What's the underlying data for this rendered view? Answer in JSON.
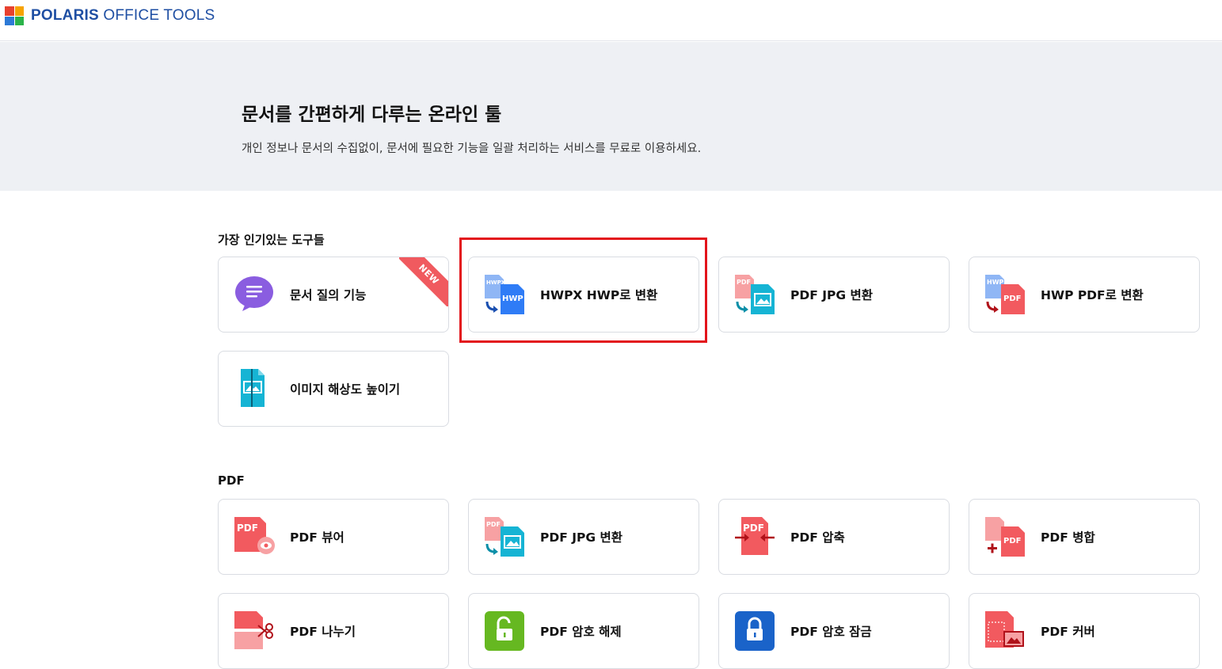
{
  "app": {
    "logo_bold": "POLARIS",
    "logo_rest": " OFFICE TOOLS",
    "logo_colors": [
      "#e8412f",
      "#f7a300",
      "#2d7ad6",
      "#2bb34a"
    ]
  },
  "hero": {
    "title": "문서를 간편하게 다루는 온라인 툴",
    "subtitle": "개인 정보나 문서의 수집없이, 문서에 필요한 기능을 일괄 처리하는 서비스를 무료로 이용하세요."
  },
  "popular": {
    "title": "가장 인기있는 도구들",
    "items": [
      {
        "label": "문서 질의 기능",
        "icon": "chat-bubble-icon",
        "badge": "NEW"
      },
      {
        "label": "HWPX HWP로 변환",
        "icon": "hwpx-to-hwp-icon"
      },
      {
        "label": "PDF JPG 변환",
        "icon": "pdf-to-jpg-icon"
      },
      {
        "label": "HWP PDF로 변환",
        "icon": "hwp-to-pdf-icon"
      },
      {
        "label": "이미지 해상도 높이기",
        "icon": "image-upscale-icon"
      }
    ]
  },
  "pdf": {
    "title": "PDF",
    "items": [
      {
        "label": "PDF 뷰어",
        "icon": "pdf-viewer-icon"
      },
      {
        "label": "PDF JPG 변환",
        "icon": "pdf-to-jpg-icon"
      },
      {
        "label": "PDF 압축",
        "icon": "pdf-compress-icon"
      },
      {
        "label": "PDF 병합",
        "icon": "pdf-merge-icon"
      },
      {
        "label": "PDF 나누기",
        "icon": "pdf-split-icon"
      },
      {
        "label": "PDF 암호 해제",
        "icon": "pdf-unlock-icon"
      },
      {
        "label": "PDF 암호 잠금",
        "icon": "pdf-lock-icon"
      },
      {
        "label": "PDF 커버",
        "icon": "pdf-cover-icon"
      }
    ]
  },
  "colors": {
    "pdf_red": "#f25a5f",
    "teal": "#16b4d4",
    "hwp_blue": "#2f7cf6",
    "purple": "#8a5de0",
    "green": "#66b821",
    "navy_blue": "#1a63c9",
    "highlight_red": "#e3141b"
  },
  "icon_text": {
    "hwpx": "HWPX",
    "hwp": "HWP",
    "pdf": "PDF"
  }
}
